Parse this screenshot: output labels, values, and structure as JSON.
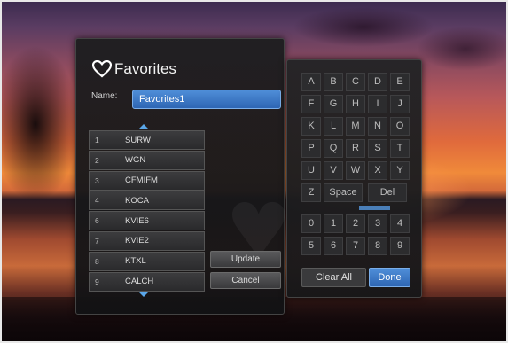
{
  "favorites": {
    "title": "Favorites",
    "name_label": "Name:",
    "name_value": "Favorites1",
    "channels": [
      {
        "num": "1",
        "name": "SURW"
      },
      {
        "num": "2",
        "name": "WGN"
      },
      {
        "num": "3",
        "name": "CFMIFM"
      },
      {
        "num": "4",
        "name": "KOCA"
      },
      {
        "num": "6",
        "name": "KVIE6"
      },
      {
        "num": "7",
        "name": "KVIE2"
      },
      {
        "num": "8",
        "name": "KTXL"
      },
      {
        "num": "9",
        "name": "CALCH"
      }
    ],
    "update_label": "Update",
    "cancel_label": "Cancel"
  },
  "keyboard": {
    "letter_rows": [
      [
        "A",
        "B",
        "C",
        "D",
        "E"
      ],
      [
        "F",
        "G",
        "H",
        "I",
        "J"
      ],
      [
        "K",
        "L",
        "M",
        "N",
        "O"
      ],
      [
        "P",
        "Q",
        "R",
        "S",
        "T"
      ],
      [
        "U",
        "V",
        "W",
        "X",
        "Y"
      ]
    ],
    "z_key": "Z",
    "space_key": "Space",
    "del_key": "Del",
    "digit_rows": [
      [
        "0",
        "1",
        "2",
        "3",
        "4"
      ],
      [
        "5",
        "6",
        "7",
        "8",
        "9"
      ]
    ],
    "clear_all_label": "Clear All",
    "done_label": "Done"
  },
  "colors": {
    "accent_blue": "#3d7cc9",
    "panel_bg": "#1e1e20"
  }
}
